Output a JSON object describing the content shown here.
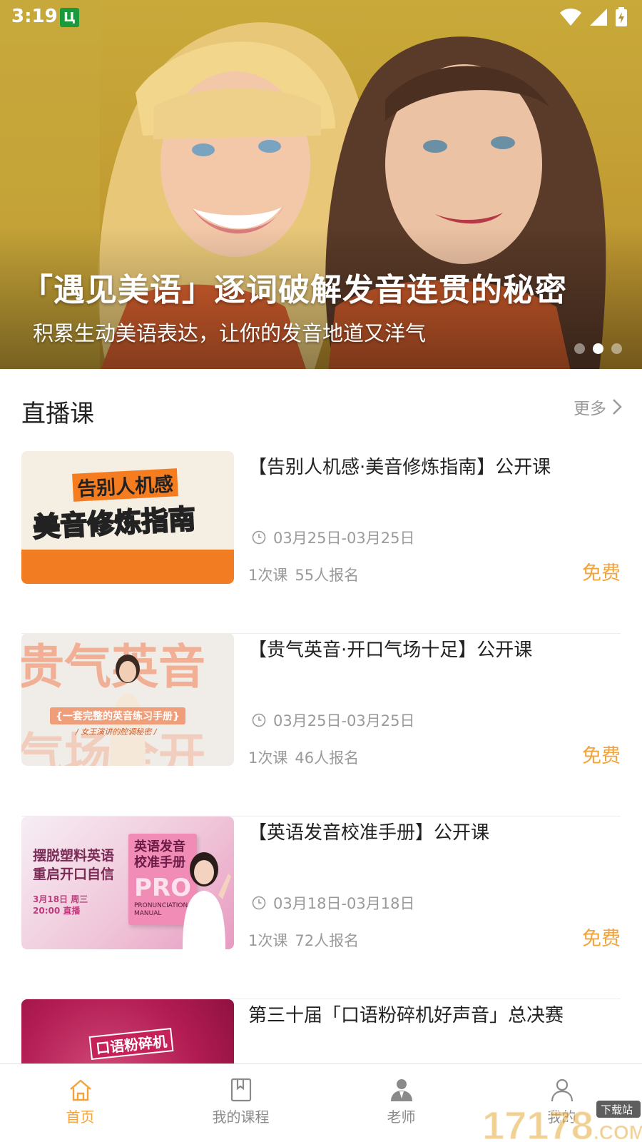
{
  "status_bar": {
    "time": "3:19",
    "app_badge": "Ц"
  },
  "banner": {
    "title": "「遇见美语」逐词破解发音连贯的秘密",
    "subtitle": "积累生动美语表达，让你的发音地道又洋气",
    "slides": 3,
    "active_slide": 2
  },
  "section": {
    "title": "直播课",
    "more_label": "更多"
  },
  "courses": [
    {
      "title": "【告别人机感·美音修炼指南】公开课",
      "date": "03月25日-03月25日",
      "lessons": "1次课",
      "enrolled": "55人报名",
      "price": "免费",
      "thumb": {
        "line1": "告别人机感",
        "line2a": "美音",
        "line2b": "修炼指南"
      }
    },
    {
      "title": "【贵气英音·开口气场十足】公开课",
      "date": "03月25日-03月25日",
      "lessons": "1次课",
      "enrolled": "46人报名",
      "price": "免费",
      "thumb": {
        "top": "贵气英音",
        "bottom": "气场全开",
        "tag": "{一套完整的英音练习手册}",
        "sub": "/ 女王演讲的腔调秘密 /"
      }
    },
    {
      "title": "【英语发音校准手册】公开课",
      "date": "03月18日-03月18日",
      "lessons": "1次课",
      "enrolled": "72人报名",
      "price": "免费",
      "thumb": {
        "left1": "摆脱塑料英语",
        "left2": "重启开口自信",
        "date1": "3月18日 周三",
        "date2": "20:00 直播",
        "book1": "英语发音",
        "book2": "校准手册",
        "book_pro": "PRO",
        "book_sub1": "PRONUNCIATION",
        "book_sub2": "MANUAL"
      }
    },
    {
      "title": "第三十届「口语粉碎机好声音」总决赛",
      "thumb": {
        "text": "口语粉碎机"
      }
    }
  ],
  "tabs": [
    {
      "label": "首页",
      "active": true
    },
    {
      "label": "我的课程",
      "active": false
    },
    {
      "label": "老师",
      "active": false
    },
    {
      "label": "我的",
      "active": false
    }
  ],
  "watermark": {
    "text": "17178",
    "badge": "下载站",
    "suffix": ".COM"
  },
  "colors": {
    "accent": "#f2a33a",
    "muted": "#9a9a9a",
    "banner": "#c4a035"
  }
}
